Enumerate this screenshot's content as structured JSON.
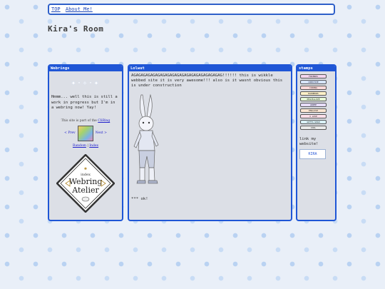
{
  "nav": {
    "links": [
      "TOP",
      "About Me!"
    ]
  },
  "site": {
    "title": "Kira's Room"
  },
  "webrings": {
    "header": "Webrings",
    "banner_text": "✦·✧·✦",
    "body": "Hmmm... well this is still a work in progress but I'm in a webring now! Yay!",
    "ring": {
      "caption": "This site is part of the",
      "ring_name": "CliRing",
      "prev": "< Prev",
      "next": "Next >",
      "random": "Random",
      "index": "Index"
    },
    "atelier": {
      "top": "index",
      "line1": "Webring",
      "line2": "Atelier"
    }
  },
  "lolwut": {
    "header": "Lolwut",
    "text": "AGAGAGAGAGAGAGAGAGAGAGAGAGAGAGAGAGAGAG!!!!!! this is wikkle webbed site it is very awesome!!! also is it wasnt obvious this is under construction",
    "footer": "*** ok!"
  },
  "stamps": {
    "header": "stamps",
    "items": [
      {
        "label": "FRIENDS",
        "color": "#f5d6ef"
      },
      {
        "label": "CREATIVE",
        "color": "#d6e4ff"
      },
      {
        "label": "CODING",
        "color": "#ffd9d9"
      },
      {
        "label": "RAINBOWS",
        "color": "#fff1c9"
      },
      {
        "label": "PEACE+LOVE",
        "color": "#e5f7d6"
      },
      {
        "label": "ANIME",
        "color": "#e6dcff"
      },
      {
        "label": "ENGLISH",
        "color": "#fde6d2"
      },
      {
        "label": "I LOVE",
        "color": "#ffe0ea"
      },
      {
        "label": "GOTTA GOGO",
        "color": "#d9f1f7"
      },
      {
        "label": "COOL",
        "color": "#eaeaea"
      }
    ],
    "link_text": "link my website!",
    "my_stamp": "KIRA"
  },
  "colors": {
    "accent": "#1f56d6",
    "panel_bg": "#dcdfe6"
  }
}
